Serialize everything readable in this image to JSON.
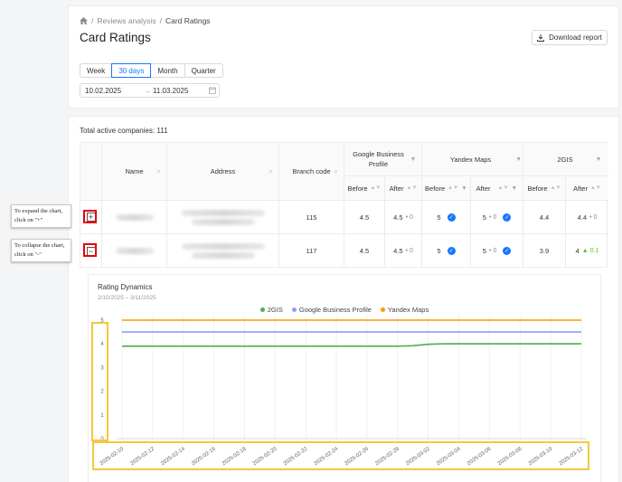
{
  "breadcrumb": {
    "parent": "Reviews analysis",
    "separator": "/",
    "current": "Card Ratings"
  },
  "page": {
    "title": "Card Ratings",
    "download_label": "Download report"
  },
  "periods": [
    "Week",
    "30 days",
    "Month",
    "Quarter"
  ],
  "active_period": "30 days",
  "date_range": {
    "start": "10.02.2025",
    "arrow": "→",
    "end": "11.03.2025"
  },
  "total_label": "Total active companies: 111",
  "table": {
    "headers": {
      "name": "Name",
      "address": "Address",
      "branch": "Branch code",
      "google": "Google Business Profile",
      "yandex": "Yandex Maps",
      "gis": "2GIS",
      "before": "Before",
      "after": "After"
    },
    "rows": [
      {
        "expand": "+",
        "branch": "115",
        "google_before": "4.5",
        "google_after": "4.5",
        "google_delta": "• 0",
        "yandex_before": "5",
        "yandex_after": "5",
        "yandex_delta": "• 0",
        "gis_before": "4.4",
        "gis_after": "4.4",
        "gis_delta": "• 0"
      },
      {
        "expand": "−",
        "branch": "117",
        "google_before": "4.5",
        "google_after": "4.5",
        "google_delta": "• 0",
        "yandex_before": "5",
        "yandex_after": "5",
        "yandex_delta": "• 0",
        "gis_before": "3.9",
        "gis_after": "4",
        "gis_delta": "▲ 0.1"
      }
    ]
  },
  "notes": {
    "expand": "To expand the chart, click on \"+\"",
    "collapse": "To collapse the chart, click on \"-\""
  },
  "chart_data": {
    "type": "line",
    "title": "Rating Dynamics",
    "subtitle": "2/10/2025 – 3/11/2025",
    "ylim": [
      0,
      5
    ],
    "y_ticks": [
      "0",
      "1",
      "2",
      "3",
      "4",
      "5"
    ],
    "x_tick_labels": [
      "2025-02-10",
      "2025-02-12",
      "2025-02-14",
      "2025-02-16",
      "2025-02-18",
      "2025-02-20",
      "2025-02-22",
      "2025-02-24",
      "2025-02-26",
      "2025-02-28",
      "2025-03-02",
      "2025-03-04",
      "2025-03-06",
      "2025-03-08",
      "2025-03-10",
      "2025-03-12"
    ],
    "x": [
      "2025-02-10",
      "2025-02-24",
      "2025-02-28",
      "2025-03-01",
      "2025-03-02",
      "2025-03-03",
      "2025-03-12"
    ],
    "legend_position": "top",
    "grid": true,
    "series": [
      {
        "name": "2GIS",
        "color": "#4caf50",
        "values": [
          3.9,
          3.9,
          3.9,
          3.92,
          3.98,
          4.0,
          4.0
        ]
      },
      {
        "name": "Google Business Profile",
        "color": "#8c9eff",
        "values": [
          4.5,
          4.5,
          4.5,
          4.5,
          4.5,
          4.5,
          4.5
        ]
      },
      {
        "name": "Yandex Maps",
        "color": "#ff9800",
        "values": [
          5,
          5,
          5,
          5,
          5,
          5,
          5
        ]
      }
    ]
  },
  "colors": {
    "accent": "#1677ff",
    "highlight": "#f5c83c",
    "annotation": "#e6000e"
  }
}
